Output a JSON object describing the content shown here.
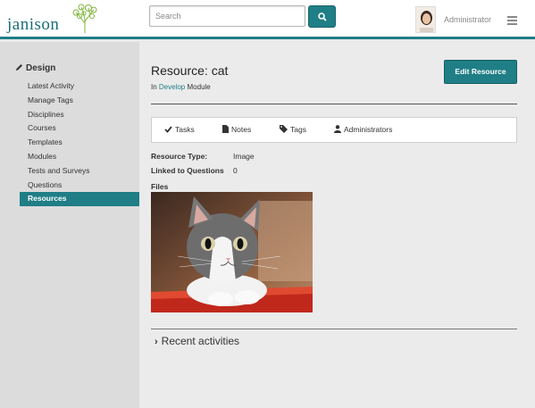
{
  "header": {
    "logo_text": "janison",
    "search_placeholder": "Search",
    "username": "Administrator"
  },
  "sidebar": {
    "title": "Design",
    "items": [
      {
        "label": "Latest Activity"
      },
      {
        "label": "Manage Tags"
      },
      {
        "label": "Disciplines"
      },
      {
        "label": "Courses"
      },
      {
        "label": "Templates"
      },
      {
        "label": "Modules"
      },
      {
        "label": "Tests and Surveys"
      },
      {
        "label": "Questions"
      },
      {
        "label": "Resources",
        "active": true
      }
    ]
  },
  "main": {
    "title": "Resource: cat",
    "breadcrumb": {
      "prefix": "In",
      "link": "Develop",
      "suffix": "Module"
    },
    "edit_button": "Edit Resource",
    "tabs": [
      {
        "label": "Tasks",
        "icon": "check-icon"
      },
      {
        "label": "Notes",
        "icon": "document-icon"
      },
      {
        "label": "Tags",
        "icon": "tag-icon"
      },
      {
        "label": "Administrators",
        "icon": "user-icon"
      }
    ],
    "properties": [
      {
        "label": "Resource Type:",
        "value": "Image"
      },
      {
        "label": "Linked to Questions",
        "value": "0"
      }
    ],
    "files_label": "Files",
    "recent_activities": "Recent activities"
  },
  "colors": {
    "accent": "#1f7e86",
    "sidebar_bg": "#dcdcdc",
    "main_bg": "#ebebeb"
  }
}
